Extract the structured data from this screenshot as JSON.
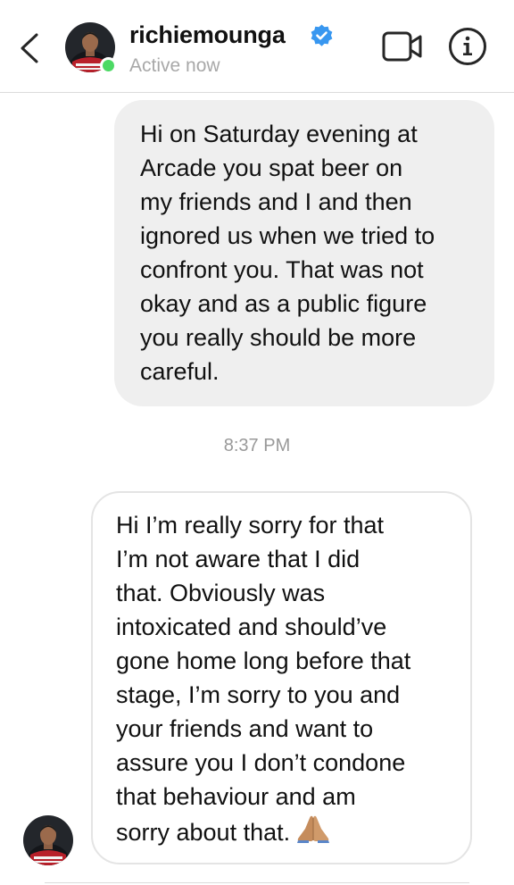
{
  "header": {
    "username": "richiemounga",
    "status": "Active now",
    "icons": {
      "back": "chevron-left-icon",
      "verified": "verified-badge-icon",
      "video": "video-camera-icon",
      "info": "info-circle-icon"
    },
    "colors": {
      "verified": "#3897f0",
      "online": "#4cd964",
      "status_text": "#a8a8a8"
    }
  },
  "messages": {
    "sent": {
      "text": "Hi on Saturday evening at\nArcade you spat beer on\nmy friends and I and then\nignored us when we tried to\nconfront you. That was not\nokay and as a public figure\nyou really should be more\ncareful.",
      "bubble_color": "#efefef"
    },
    "timestamp": "8:37 PM",
    "received": {
      "text": "Hi I’m really sorry for that\nI’m not aware that I did\nthat. Obviously was\nintoxicated and should’ve\ngone home long before that\nstage, I’m sorry to you and\nyour friends and want to\nassure you I don’t condone\nthat behaviour and am\nsorry about that.",
      "emoji": "folded-hands-emoji",
      "bubble_border_color": "#e4e4e4"
    }
  }
}
